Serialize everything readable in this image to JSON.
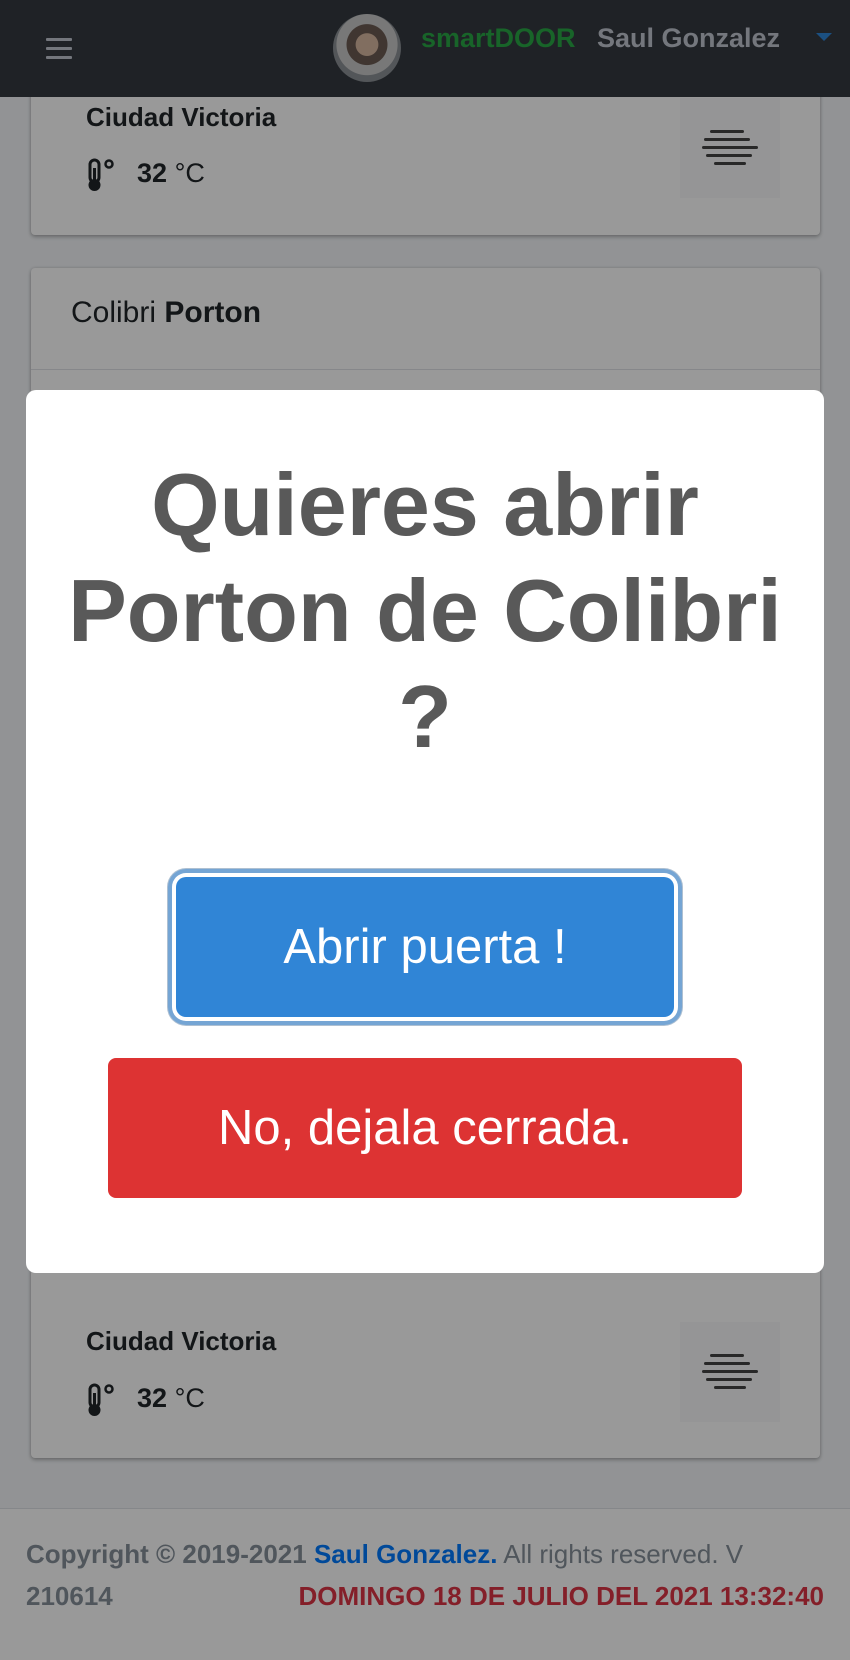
{
  "navbar": {
    "brand": "smartDOOR",
    "username": "Saul Gonzalez"
  },
  "weather_top": {
    "city": "Ciudad Victoria",
    "temp_value": "32",
    "temp_unit": "°C"
  },
  "device_card": {
    "title_prefix": "Colibri",
    "title_bold": "Porton"
  },
  "weather_bottom": {
    "city": "Ciudad Victoria",
    "temp_value": "32",
    "temp_unit": "°C"
  },
  "modal": {
    "title": "Quieres abrir Porton de Colibri ?",
    "confirm_label": "Abrir puerta !",
    "cancel_label": "No, dejala cerrada."
  },
  "footer": {
    "copyright": "Copyright © 2019-2021",
    "author": "Saul Gonzalez.",
    "rights": "All rights reserved. V",
    "version": "210614",
    "datetime": "DOMINGO 18 DE JULIO DEL 2021 13:32:40"
  },
  "colors": {
    "brand": "#28a745",
    "confirm": "#3085d6",
    "cancel": "#dd3333",
    "date": "#dc3545"
  },
  "icons": [
    "menu-icon",
    "thermometer-icon",
    "fog-icon",
    "dropdown-caret-icon"
  ]
}
